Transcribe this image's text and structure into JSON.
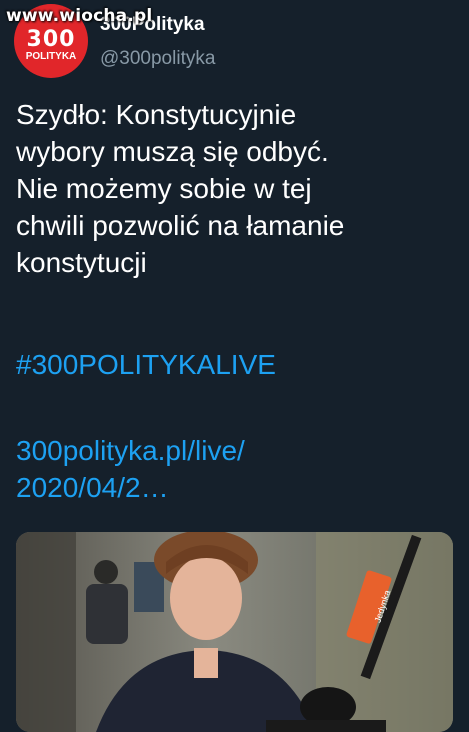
{
  "watermark": "www.wiocha.pl",
  "avatar": {
    "number": "300",
    "label": "POLITYKA"
  },
  "account": {
    "display_name": "300Polityka",
    "handle": "@300polityka"
  },
  "tweet": {
    "lines": [
      "Szydło: Konstytucyjnie",
      "wybory muszą się odbyć.",
      "Nie możemy sobie w tej",
      "chwili pozwolić na łamanie",
      "konstytucji"
    ],
    "hashtag": "#300POLITYKALIVE",
    "link_lines": [
      "300polityka.pl/live/",
      "2020/04/2…"
    ]
  },
  "media": {
    "mic_flag_text": "Jedynka"
  }
}
